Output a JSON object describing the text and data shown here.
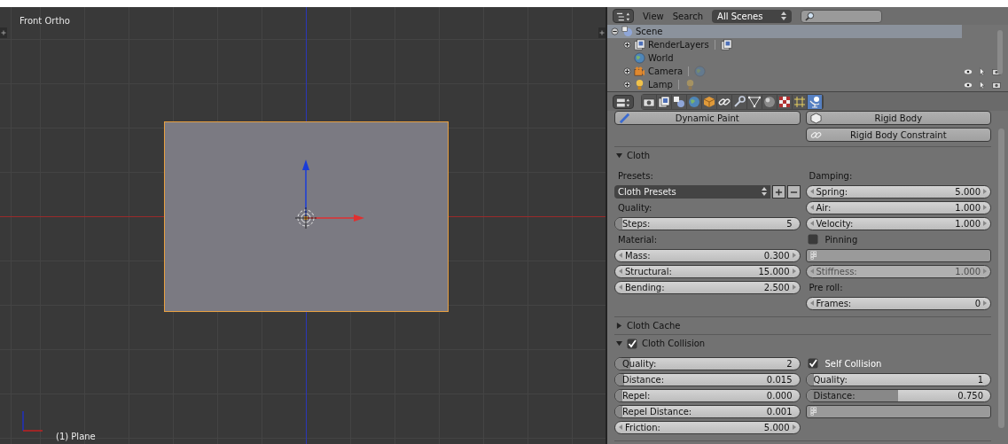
{
  "viewport": {
    "view_name": "Front Ortho",
    "object_label": "(1) Plane"
  },
  "outliner": {
    "menus": [
      "View",
      "Search"
    ],
    "scene_filter": "All Scenes",
    "tree": [
      {
        "name": "Scene",
        "kind": "scene",
        "expanded": true,
        "selected": true,
        "children": [
          {
            "name": "RenderLayers",
            "kind": "layers",
            "expanded": false,
            "selected": false
          },
          {
            "name": "World",
            "kind": "world",
            "selected": false
          },
          {
            "name": "Camera",
            "kind": "camera",
            "expanded": false,
            "selected": false
          },
          {
            "name": "Lamp",
            "kind": "lamp",
            "expanded": false,
            "selected": false
          }
        ]
      }
    ]
  },
  "properties": {
    "tabs": [
      {
        "selected": false
      },
      {
        "selected": false
      },
      {
        "selected": false
      },
      {
        "selected": false
      },
      {
        "selected": false
      },
      {
        "selected": false
      },
      {
        "selected": false
      },
      {
        "selected": false
      },
      {
        "selected": false
      },
      {
        "selected": false
      },
      {
        "selected": false
      },
      {
        "selected": true
      }
    ],
    "physics_buttons": [
      {
        "label": "Dynamic Paint"
      },
      {
        "label": "Rigid Body"
      },
      {
        "label": "Rigid Body Constraint"
      }
    ],
    "panels": [
      {
        "title": "Cloth",
        "expanded": true,
        "left": [
          {
            "kind": "label",
            "text": "Presets:"
          },
          {
            "kind": "preset",
            "text": "Cloth Presets"
          },
          {
            "kind": "label",
            "text": "Quality:"
          },
          {
            "kind": "slider",
            "label": "Steps:",
            "value": "5",
            "level": 0.04
          },
          {
            "kind": "label",
            "text": "Material:"
          },
          {
            "kind": "number",
            "label": "Mass:",
            "value": "0.300",
            "disabled": false
          },
          {
            "kind": "number",
            "label": "Structural:",
            "value": "15.000",
            "disabled": false
          },
          {
            "kind": "number",
            "label": "Bending:",
            "value": "2.500",
            "disabled": false
          }
        ],
        "right": [
          {
            "kind": "label",
            "text": "Damping:"
          },
          {
            "kind": "number",
            "label": "Spring:",
            "value": "5.000",
            "disabled": false
          },
          {
            "kind": "number",
            "label": "Air:",
            "value": "1.000",
            "disabled": false
          },
          {
            "kind": "number",
            "label": "Velocity:",
            "value": "1.000",
            "disabled": false
          },
          {
            "kind": "checkbox",
            "label": "Pinning",
            "checked": false
          },
          {
            "kind": "vgroup"
          },
          {
            "kind": "number",
            "label": "Stiffness:",
            "value": "1.000",
            "disabled": true
          },
          {
            "kind": "label",
            "text": "Pre roll:"
          },
          {
            "kind": "number",
            "label": "Frames:",
            "value": "0",
            "disabled": false
          }
        ]
      },
      {
        "title": "Cloth Cache",
        "expanded": false
      },
      {
        "title": "Cloth Collision",
        "expanded": true,
        "checked": true,
        "left": [
          {
            "kind": "slider",
            "label": "Quality:",
            "value": "2",
            "level": 0.08
          },
          {
            "kind": "slider",
            "label": "Distance:",
            "value": "0.015",
            "level": 0.05
          },
          {
            "kind": "slider",
            "label": "Repel:",
            "value": "0.000",
            "level": 0.04
          },
          {
            "kind": "slider",
            "label": "Repel Distance:",
            "value": "0.001",
            "level": 0.04
          },
          {
            "kind": "number",
            "label": "Friction:",
            "value": "5.000",
            "disabled": false
          }
        ],
        "right": [
          {
            "kind": "checkbox",
            "label": "Self Collision",
            "checked": true
          },
          {
            "kind": "slider",
            "label": "Quality:",
            "value": "1",
            "level": 0.04
          },
          {
            "kind": "slider",
            "label": "Distance:",
            "value": "0.750",
            "level": 0.5
          },
          {
            "kind": "vgroup"
          }
        ]
      }
    ]
  }
}
